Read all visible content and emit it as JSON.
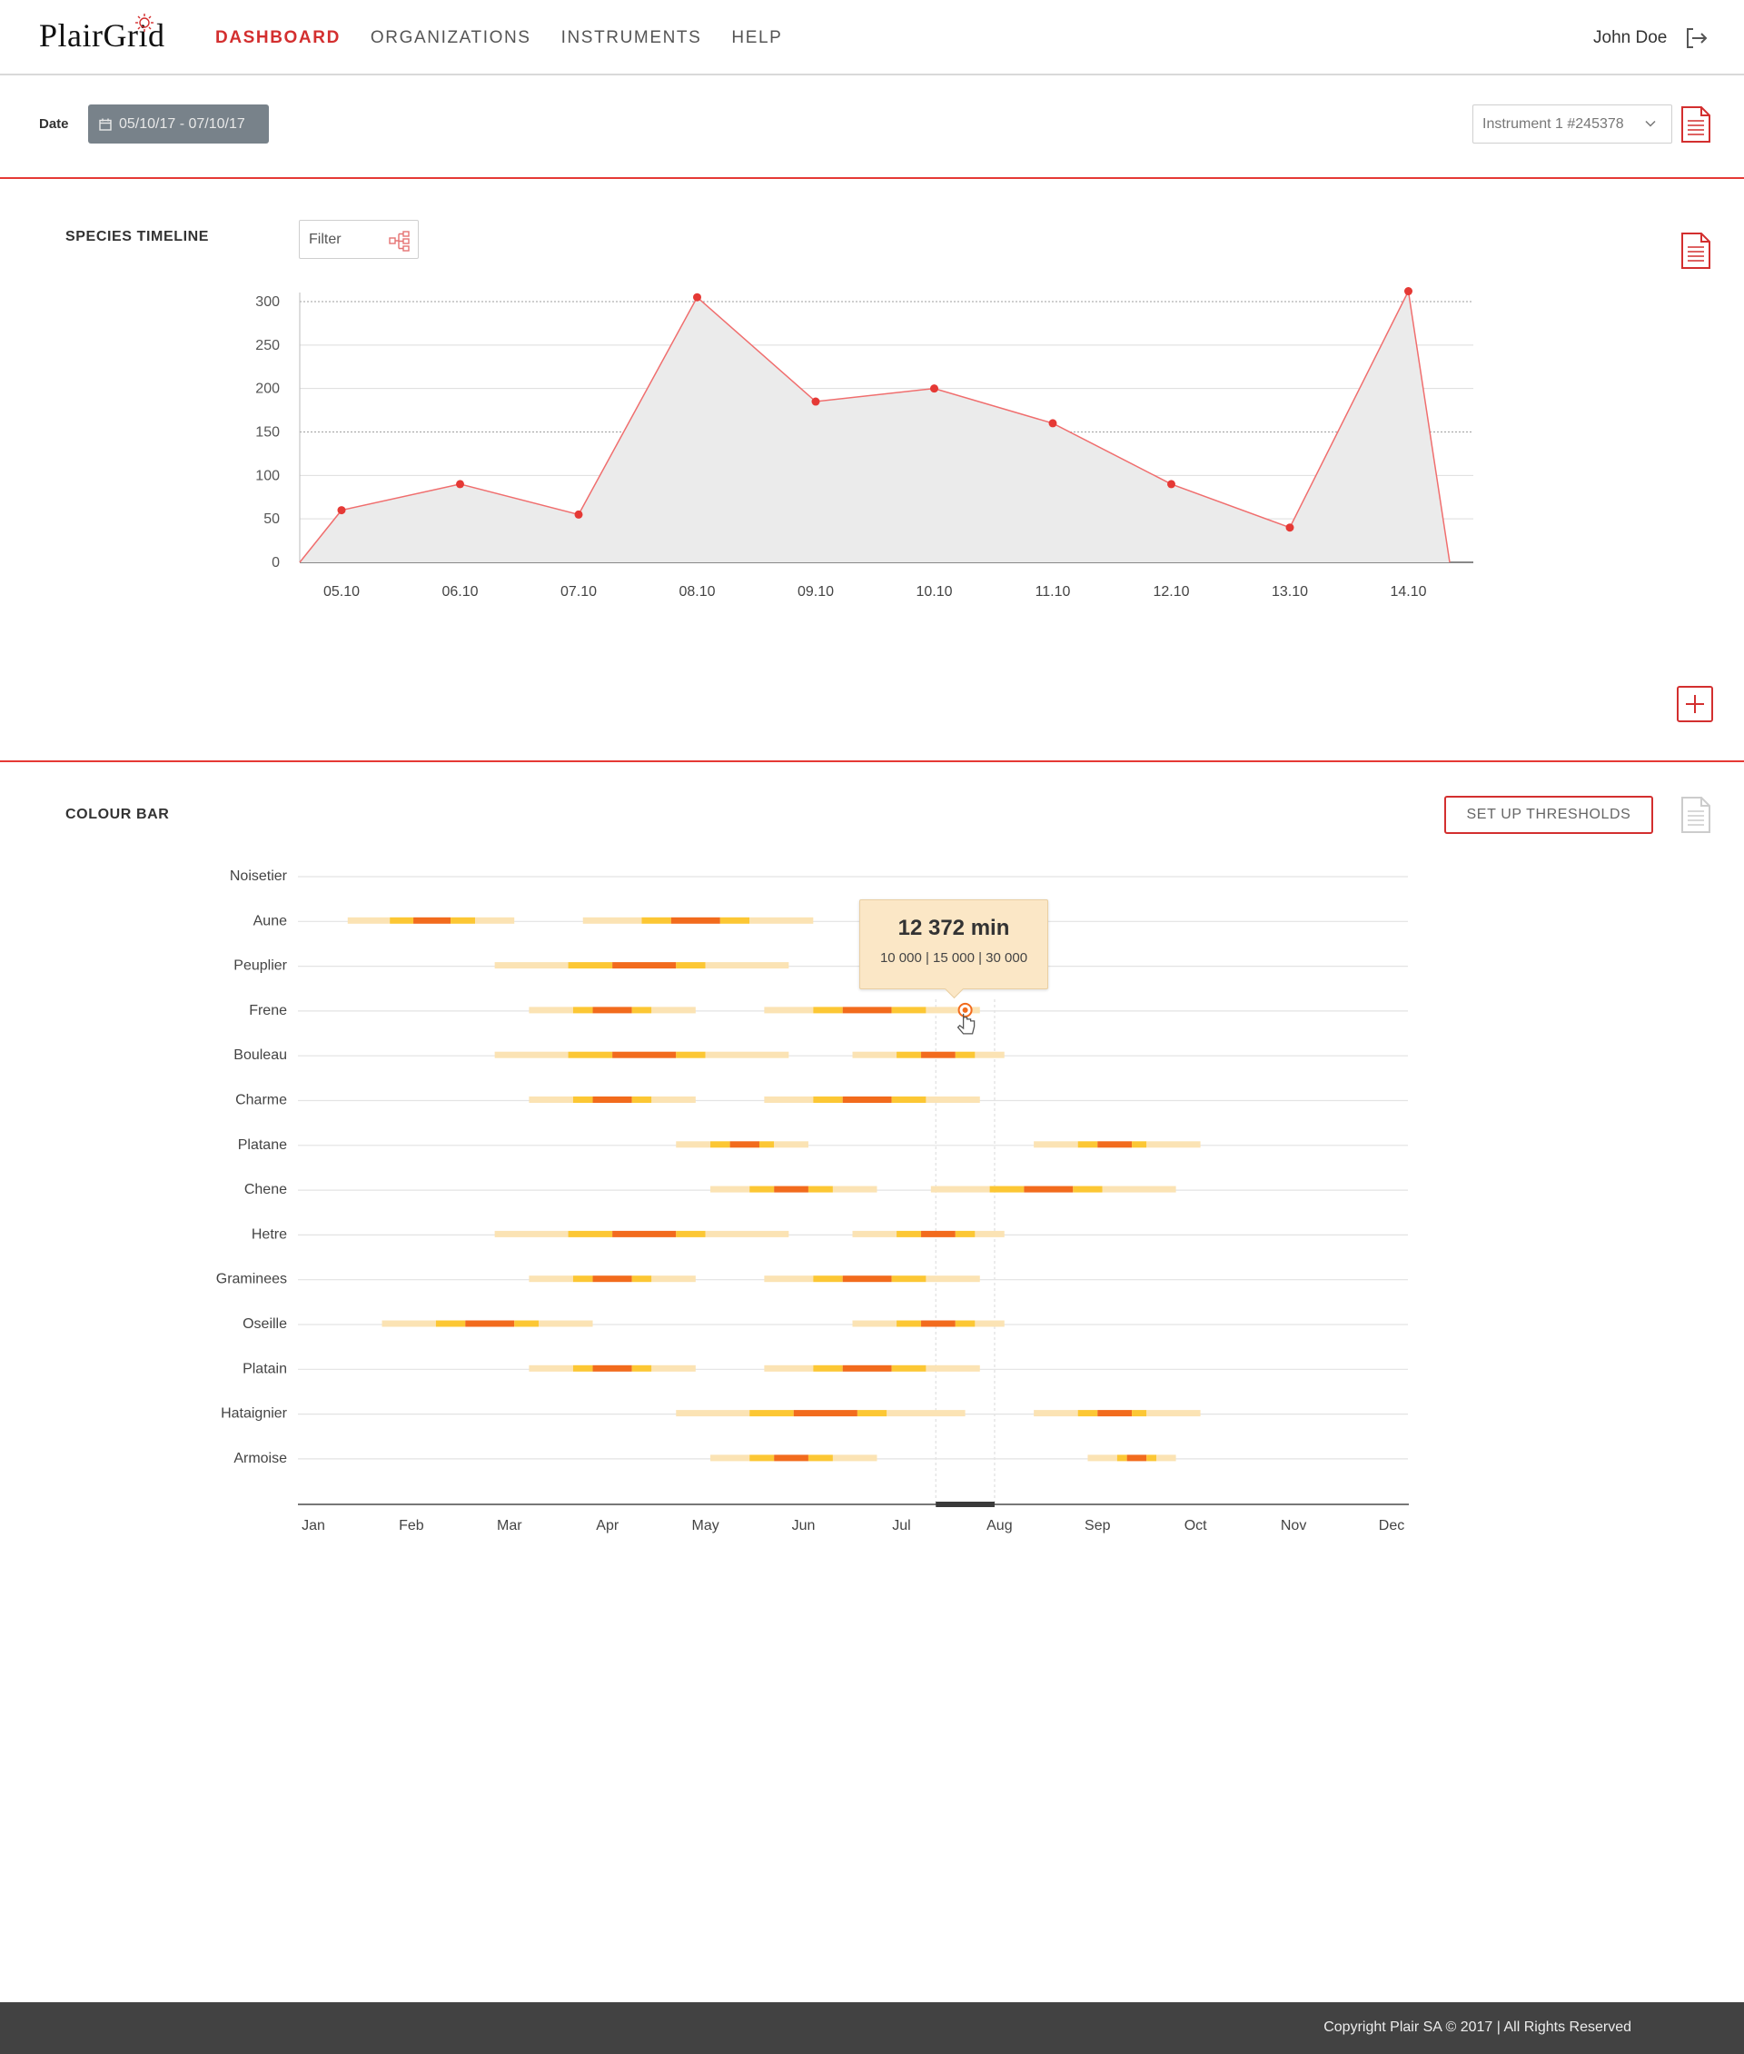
{
  "header": {
    "logo": "PlairGrid",
    "nav": [
      {
        "label": "DASHBOARD",
        "active": true
      },
      {
        "label": "ORGANIZATIONS",
        "active": false
      },
      {
        "label": "INSTRUMENTS",
        "active": false
      },
      {
        "label": "HELP",
        "active": false
      }
    ],
    "user": "John Doe",
    "logout_icon": "logout-icon"
  },
  "filters": {
    "date_label": "Date",
    "date_range": "05/10/17 - 07/10/17",
    "date_icon": "calendar-icon",
    "instrument": "Instrument 1 #245378"
  },
  "timeline": {
    "title": "SPECIES TIMELINE",
    "filter_label": "Filter",
    "filter_icon": "hierarchy-icon"
  },
  "colour_bar": {
    "title": "COLOUR BAR",
    "thresholds_button": "SET UP THRESHOLDS",
    "tooltip": {
      "value": "12 372",
      "unit": "min",
      "thresholds": "10 000 | 15 000 | 30 000"
    }
  },
  "footer": {
    "copyright": "Copyright Plair SA © 2017 | All Rights Reserved"
  },
  "colors": {
    "accent": "#d32f2f",
    "line": "#f06e6e",
    "point": "#e53935",
    "area": "#ebebeb",
    "low": "#fbe3b4",
    "mid": "#fcc734",
    "high": "#f26b1d",
    "footer": "#424242"
  },
  "chart_data": [
    {
      "type": "area",
      "x": [
        "05.10",
        "06.10",
        "07.10",
        "08.10",
        "09.10",
        "10.10",
        "11.10",
        "12.10",
        "13.10",
        "14.10"
      ],
      "series": [
        {
          "values": [
            60,
            90,
            55,
            305,
            185,
            200,
            160,
            90,
            40,
            312
          ]
        }
      ],
      "ylim": [
        0,
        300
      ],
      "yticks": [
        0,
        50,
        100,
        150,
        200,
        250,
        300
      ],
      "grid": true
    },
    {
      "type": "bar",
      "categories": [
        "Noisetier",
        "Aune",
        "Peuplier",
        "Frene",
        "Bouleau",
        "Charme",
        "Platane",
        "Chene",
        "Hetre",
        "Graminees",
        "Oseille",
        "Platain",
        "Hataignier",
        "Armoise"
      ],
      "months": [
        "Jan",
        "Feb",
        "Mar",
        "Apr",
        "May",
        "Jun",
        "Jul",
        "Aug",
        "Sep",
        "Oct",
        "Nov",
        "Dec"
      ],
      "segment_order": [
        "low",
        "mid",
        "high",
        "mid",
        "low"
      ],
      "series": [
        {
          "category": "Noisetier",
          "bars": []
        },
        {
          "category": "Aune",
          "bars": [
            [
              0.35,
              0.78,
              1.02,
              1.4,
              1.65,
              2.05
            ],
            [
              2.75,
              3.35,
              3.65,
              4.15,
              4.45,
              5.1
            ]
          ]
        },
        {
          "category": "Peuplier",
          "bars": [
            [
              1.85,
              2.6,
              3.05,
              3.7,
              4.0,
              4.85
            ]
          ]
        },
        {
          "category": "Frene",
          "bars": [
            [
              2.2,
              2.65,
              2.85,
              3.25,
              3.45,
              3.9
            ],
            [
              4.6,
              5.1,
              5.4,
              5.9,
              6.25,
              6.8
            ]
          ]
        },
        {
          "category": "Bouleau",
          "bars": [
            [
              1.85,
              2.6,
              3.05,
              3.7,
              4.0,
              4.85
            ],
            [
              5.5,
              5.95,
              6.2,
              6.55,
              6.75,
              7.05
            ]
          ]
        },
        {
          "category": "Charme",
          "bars": [
            [
              2.2,
              2.65,
              2.85,
              3.25,
              3.45,
              3.9
            ],
            [
              4.6,
              5.1,
              5.4,
              5.9,
              6.25,
              6.8
            ]
          ]
        },
        {
          "category": "Platane",
          "bars": [
            [
              3.7,
              4.05,
              4.25,
              4.55,
              4.7,
              5.05
            ],
            [
              7.35,
              7.8,
              8.0,
              8.35,
              8.5,
              9.05
            ]
          ]
        },
        {
          "category": "Chene",
          "bars": [
            [
              4.05,
              4.45,
              4.7,
              5.05,
              5.3,
              5.75
            ],
            [
              6.3,
              6.9,
              7.25,
              7.75,
              8.05,
              8.8
            ]
          ]
        },
        {
          "category": "Hetre",
          "bars": [
            [
              1.85,
              2.6,
              3.05,
              3.7,
              4.0,
              4.85
            ],
            [
              5.5,
              5.95,
              6.2,
              6.55,
              6.75,
              7.05
            ]
          ]
        },
        {
          "category": "Graminees",
          "bars": [
            [
              2.2,
              2.65,
              2.85,
              3.25,
              3.45,
              3.9
            ],
            [
              4.6,
              5.1,
              5.4,
              5.9,
              6.25,
              6.8
            ]
          ]
        },
        {
          "category": "Oseille",
          "bars": [
            [
              0.7,
              1.25,
              1.55,
              2.05,
              2.3,
              2.85
            ],
            [
              5.5,
              5.95,
              6.2,
              6.55,
              6.75,
              7.05
            ]
          ]
        },
        {
          "category": "Platain",
          "bars": [
            [
              2.2,
              2.65,
              2.85,
              3.25,
              3.45,
              3.9
            ],
            [
              4.6,
              5.1,
              5.4,
              5.9,
              6.25,
              6.8
            ]
          ]
        },
        {
          "category": "Hataignier",
          "bars": [
            [
              3.7,
              4.45,
              4.9,
              5.55,
              5.85,
              6.65
            ],
            [
              7.35,
              7.8,
              8.0,
              8.35,
              8.5,
              9.05
            ]
          ]
        },
        {
          "category": "Armoise",
          "bars": [
            [
              4.05,
              4.45,
              4.7,
              5.05,
              5.3,
              5.75
            ],
            [
              7.9,
              8.2,
              8.3,
              8.5,
              8.6,
              8.8
            ]
          ]
        }
      ],
      "highlight": {
        "category": "Frene",
        "month_position": 6.65,
        "range": [
          6.35,
          6.95
        ]
      }
    }
  ]
}
